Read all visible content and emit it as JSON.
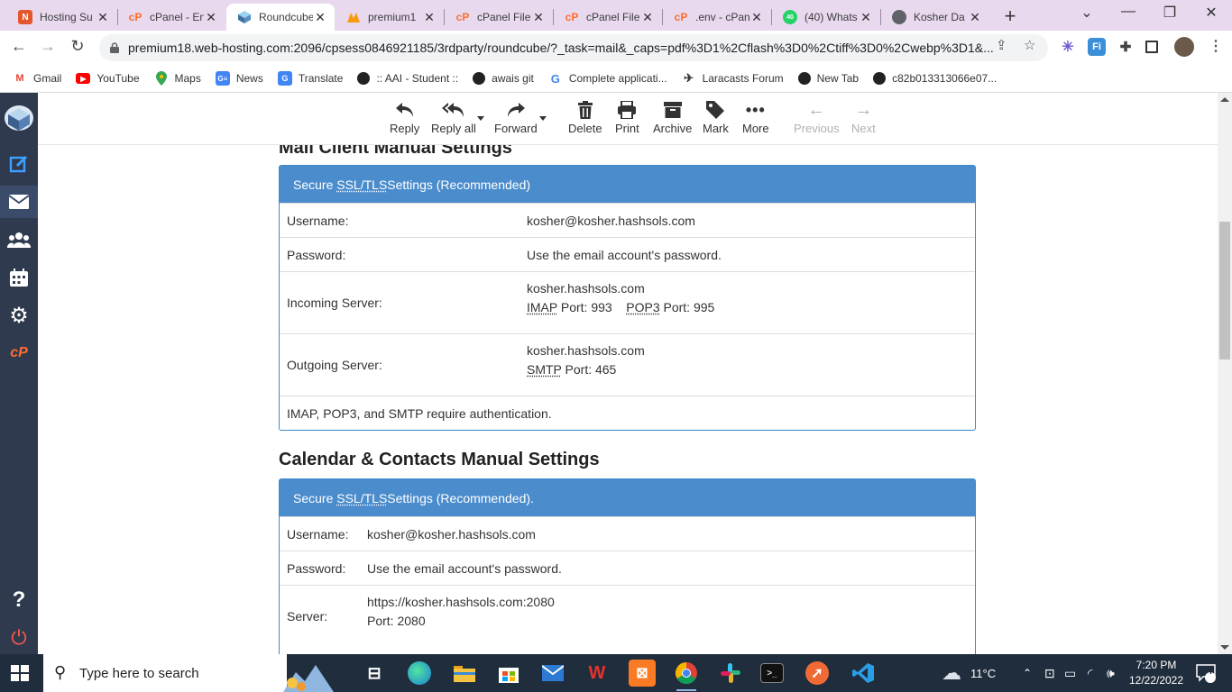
{
  "browser": {
    "tabs": [
      {
        "label": "Hosting Su",
        "icon": "n-icon",
        "color": "#e4572e"
      },
      {
        "label": "cPanel - En",
        "icon": "cpanel-icon",
        "color": "#ff6c2c"
      },
      {
        "label": "Roundcube",
        "icon": "roundcube-icon",
        "color": "#37beff",
        "active": true
      },
      {
        "label": "premium1",
        "icon": "phpmyadmin-icon",
        "color": "#f89c0e"
      },
      {
        "label": "cPanel File",
        "icon": "cpanel-icon",
        "color": "#ff6c2c"
      },
      {
        "label": "cPanel File",
        "icon": "cpanel-icon",
        "color": "#ff6c2c"
      },
      {
        "label": ".env - cPan",
        "icon": "cpanel-icon",
        "color": "#ff6c2c"
      },
      {
        "label": "(40) Whats",
        "icon": "whatsapp-icon",
        "color": "#25d366",
        "badge": "40"
      },
      {
        "label": "Kosher Da",
        "icon": "globe-icon",
        "color": "#5f6368"
      }
    ],
    "url": "premium18.web-hosting.com:2096/cpsess0846921185/3rdparty/roundcube/?_task=mail&_caps=pdf%3D1%2Cflash%3D0%2Ctiff%3D0%2Cwebp%3D1&...",
    "bookmarks": [
      {
        "label": "Gmail",
        "icon": "gmail-icon"
      },
      {
        "label": "YouTube",
        "icon": "youtube-icon"
      },
      {
        "label": "Maps",
        "icon": "maps-icon"
      },
      {
        "label": "News",
        "icon": "news-icon"
      },
      {
        "label": "Translate",
        "icon": "translate-icon"
      },
      {
        "label": ":: AAI - Student ::",
        "icon": "globe-icon"
      },
      {
        "label": "awais git",
        "icon": "github-icon"
      },
      {
        "label": "Complete applicati...",
        "icon": "google-icon"
      },
      {
        "label": "Laracasts Forum",
        "icon": "laracasts-icon"
      },
      {
        "label": "New Tab",
        "icon": "globe-icon"
      },
      {
        "label": "c82b013313066e07...",
        "icon": "globe-icon"
      }
    ]
  },
  "rc_toolbar": {
    "reply": "Reply",
    "reply_all": "Reply all",
    "forward": "Forward",
    "delete": "Delete",
    "print": "Print",
    "archive": "Archive",
    "mark": "Mark",
    "more": "More",
    "previous": "Previous",
    "next": "Next"
  },
  "mail_section": {
    "heading": "Mail Client Manual Settings",
    "panel_prefix": "Secure ",
    "panel_abbr": "SSL/TLS",
    "panel_suffix": " Settings (Recommended)",
    "username_label": "Username:",
    "username_value": "kosher@kosher.hashsols.com",
    "password_label": "Password:",
    "password_value": "Use the email account's password.",
    "incoming_label": "Incoming Server:",
    "incoming_host": "kosher.hashsols.com",
    "imap": "IMAP",
    "imap_port": " Port: 993",
    "pop3": "POP3",
    "pop3_port": " Port: 995",
    "outgoing_label": "Outgoing Server:",
    "outgoing_host": "kosher.hashsols.com",
    "smtp": "SMTP",
    "smtp_port": " Port: 465",
    "auth_note": "IMAP, POP3, and SMTP require authentication."
  },
  "cal_section": {
    "heading": "Calendar & Contacts Manual Settings",
    "panel_prefix": "Secure ",
    "panel_abbr": "SSL/TLS",
    "panel_suffix": " Settings (Recommended).",
    "username_label": "Username:",
    "username_value": "kosher@kosher.hashsols.com",
    "password_label": "Password:",
    "password_value": "Use the email account's password.",
    "server_label": "Server:",
    "server_url": "https://kosher.hashsols.com:2080",
    "server_port": "Port: 2080"
  },
  "taskbar": {
    "search_placeholder": "Type here to search",
    "weather": "11°C",
    "time": "7:20 PM",
    "date": "12/22/2022",
    "notifications": "7"
  },
  "colors": {
    "rail_bg": "#2f3a4f",
    "panel_header": "#4b8ccc",
    "tabstrip": "#e8d9ef",
    "taskbar": "#1f2d3d"
  }
}
